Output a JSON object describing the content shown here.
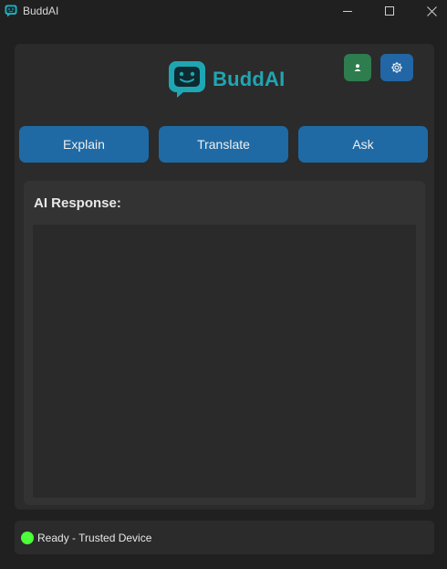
{
  "window": {
    "title": "BuddAI"
  },
  "header": {
    "logo_text": "BuddAI",
    "profile_icon": "person-icon",
    "settings_icon": "gear-icon"
  },
  "actions": {
    "explain": "Explain",
    "translate": "Translate",
    "ask": "Ask"
  },
  "response": {
    "title": "AI Response:",
    "content": ""
  },
  "status": {
    "text": "Ready - Trusted Device",
    "indicator_color": "#4cff3a"
  },
  "colors": {
    "brand": "#1fa6b3",
    "action_button": "#1f6aa5",
    "profile_button": "#2e7d4f",
    "settings_button": "#2266a6"
  }
}
